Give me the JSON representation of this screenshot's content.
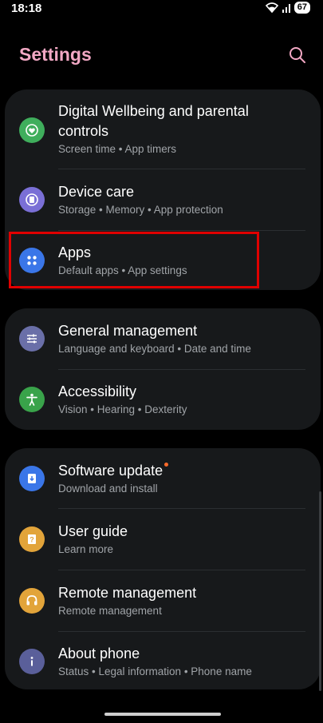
{
  "status": {
    "time": "18:18",
    "battery": "67"
  },
  "header": {
    "title": "Settings"
  },
  "items": [
    {
      "title_line1": "Digital Wellbeing and parental",
      "title_line2": "controls",
      "subtitle": "Screen time  •  App timers",
      "icon": "wellbeing-heart-icon",
      "color": "#3fae5c"
    },
    {
      "title": "Device care",
      "subtitle": "Storage  •  Memory  •  App protection",
      "icon": "device-care-icon",
      "color": "#7a6fd6"
    },
    {
      "title": "Apps",
      "subtitle": "Default apps  •  App settings",
      "icon": "apps-grid-icon",
      "color": "#3a76e8"
    },
    {
      "title": "General management",
      "subtitle": "Language and keyboard  •  Date and time",
      "icon": "sliders-icon",
      "color": "#6a6fa8"
    },
    {
      "title": "Accessibility",
      "subtitle": "Vision  •  Hearing  •  Dexterity",
      "icon": "accessibility-person-icon",
      "color": "#39a34a"
    },
    {
      "title": "Software update",
      "subtitle": "Download and install",
      "icon": "software-update-icon",
      "color": "#3a76e8"
    },
    {
      "title": "User guide",
      "subtitle": "Learn more",
      "icon": "user-guide-icon",
      "color": "#e2a43a"
    },
    {
      "title": "Remote management",
      "subtitle": "Remote management",
      "icon": "headset-icon",
      "color": "#e2a43a"
    },
    {
      "title": "About phone",
      "subtitle": "Status  •  Legal information  •  Phone name",
      "icon": "info-icon",
      "color": "#5a5f9a"
    }
  ]
}
